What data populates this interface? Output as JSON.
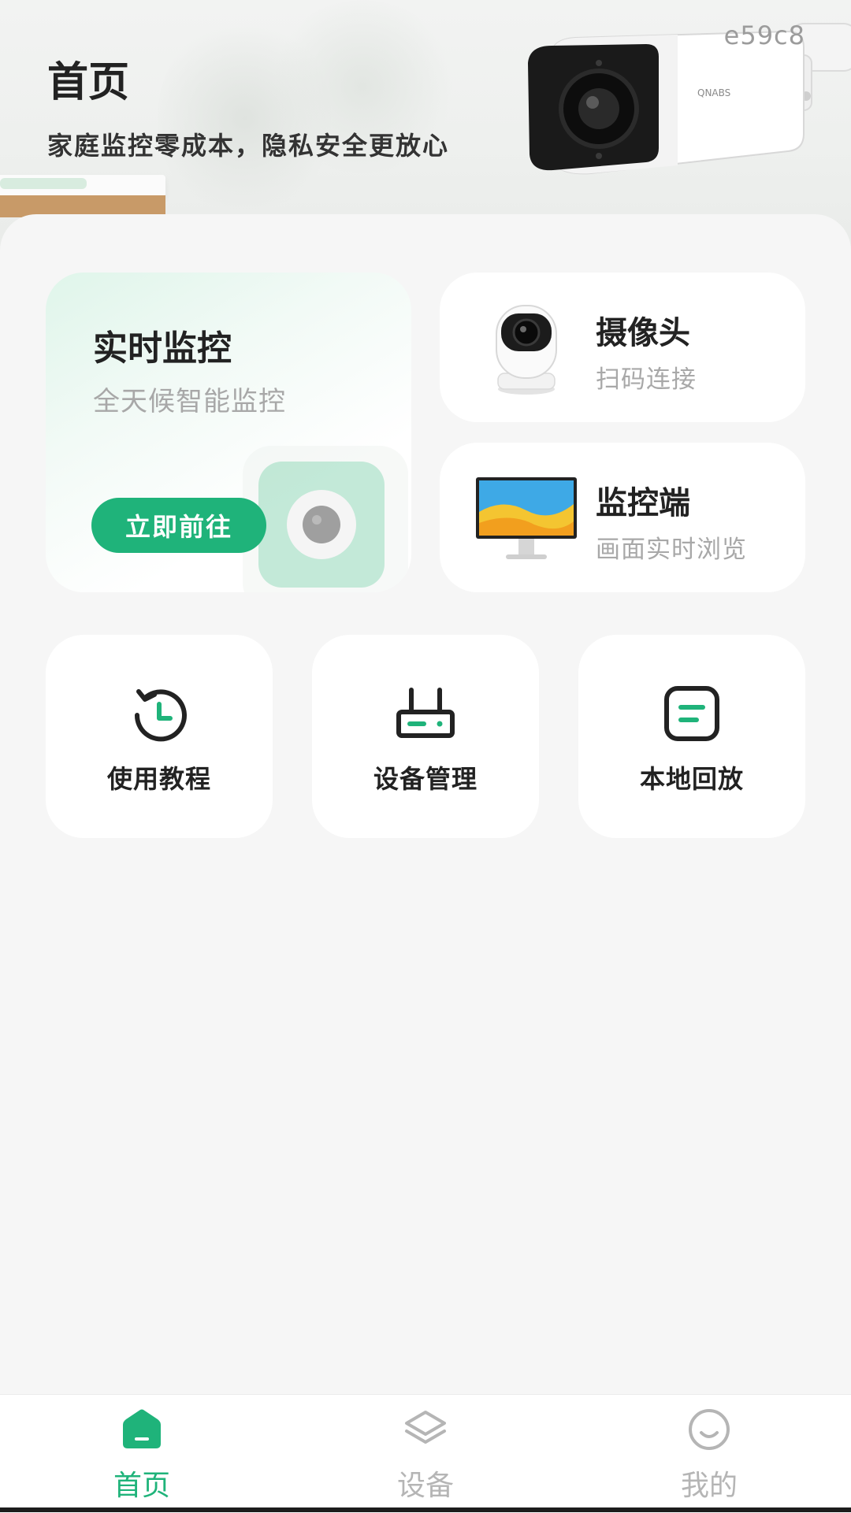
{
  "header": {
    "title": "首页",
    "subtitle": "家庭监控零成本，隐私安全更放心",
    "watermark": "e59c8"
  },
  "live_card": {
    "title": "实时监控",
    "subtitle": "全天候智能监控",
    "button_label": "立即前往"
  },
  "camera_card": {
    "title": "摄像头",
    "subtitle": "扫码连接"
  },
  "monitor_card": {
    "title": "监控端",
    "subtitle": "画面实时浏览"
  },
  "tiles": [
    {
      "label": "使用教程",
      "icon": "history-icon"
    },
    {
      "label": "设备管理",
      "icon": "router-icon"
    },
    {
      "label": "本地回放",
      "icon": "playback-icon"
    }
  ],
  "bottom_nav": [
    {
      "label": "首页",
      "icon": "home-icon",
      "active": true
    },
    {
      "label": "设备",
      "icon": "layers-icon",
      "active": false
    },
    {
      "label": "我的",
      "icon": "smile-icon",
      "active": false
    }
  ],
  "colors": {
    "accent": "#1fb37a",
    "nav_inactive": "#b5b5b5",
    "subtext": "#a8a8a8"
  }
}
